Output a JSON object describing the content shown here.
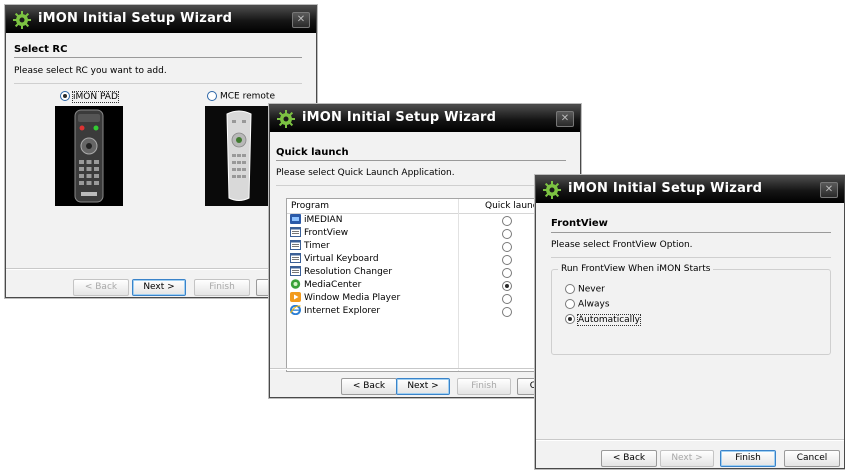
{
  "wizard_title": "iMON Initial Setup Wizard",
  "close_glyph": "✕",
  "buttons": {
    "back": "< Back",
    "next": "Next >",
    "finish": "Finish",
    "cancel": "Cancel"
  },
  "window1": {
    "heading": "Select RC",
    "description": "Please select RC you want to add.",
    "options": [
      {
        "label": "iMON PAD",
        "selected": true
      },
      {
        "label": "MCE remote",
        "selected": false
      }
    ]
  },
  "window2": {
    "heading": "Quick launch",
    "description": "Please select Quick Launch Application.",
    "columns": [
      "Program",
      "Quick launch"
    ],
    "rows": [
      {
        "name": "iMEDIAN",
        "icon": "imedian-icon",
        "selected": false
      },
      {
        "name": "FrontView",
        "icon": "app-window-icon",
        "selected": false
      },
      {
        "name": "Timer",
        "icon": "app-window-icon",
        "selected": false
      },
      {
        "name": "Virtual Keyboard",
        "icon": "app-window-icon",
        "selected": false
      },
      {
        "name": "Resolution Changer",
        "icon": "app-window-icon",
        "selected": false
      },
      {
        "name": "MediaCenter",
        "icon": "media-center-icon",
        "selected": true
      },
      {
        "name": "Window Media Player",
        "icon": "media-player-icon",
        "selected": false
      },
      {
        "name": "Internet Explorer",
        "icon": "internet-explorer-icon",
        "selected": false
      }
    ]
  },
  "window3": {
    "heading": "FrontView",
    "description": "Please select FrontView Option.",
    "group_label": "Run FrontView When iMON Starts",
    "options": [
      {
        "label": "Never",
        "selected": false
      },
      {
        "label": "Always",
        "selected": false
      },
      {
        "label": "Automatically",
        "selected": true
      }
    ]
  },
  "colors": {
    "title_bar": "#111111",
    "client_bg": "#f2f2f2",
    "default_button_border": "#3a83c9",
    "logo_green": "#7cc242"
  }
}
